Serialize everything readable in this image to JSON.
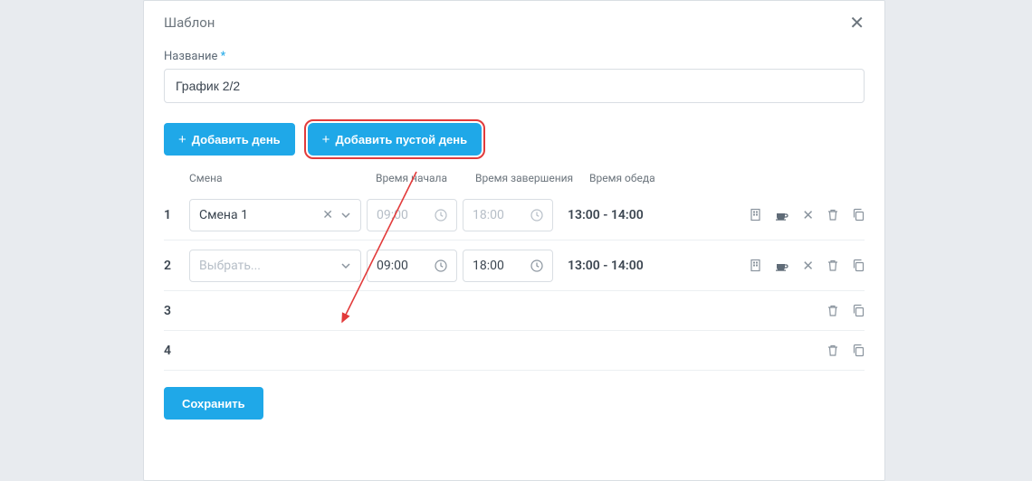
{
  "modal": {
    "title": "Шаблон",
    "name_label": "Название",
    "name_value": "График 2/2",
    "add_day": "Добавить день",
    "add_empty_day": "Добавить пустой день",
    "save": "Сохранить"
  },
  "columns": {
    "shift": "Смена",
    "start": "Время начала",
    "end": "Время завершения",
    "lunch": "Время обеда"
  },
  "rows": [
    {
      "idx": "1",
      "shift": "Смена 1",
      "shift_placeholder": false,
      "start": "09:00",
      "end": "18:00",
      "disabled": true,
      "lunch": "13:00 - 14:00",
      "full": true
    },
    {
      "idx": "2",
      "shift": "Выбрать...",
      "shift_placeholder": true,
      "start": "09:00",
      "end": "18:00",
      "disabled": false,
      "lunch": "13:00 - 14:00",
      "full": true
    },
    {
      "idx": "3",
      "full": false
    },
    {
      "idx": "4",
      "full": false
    }
  ]
}
